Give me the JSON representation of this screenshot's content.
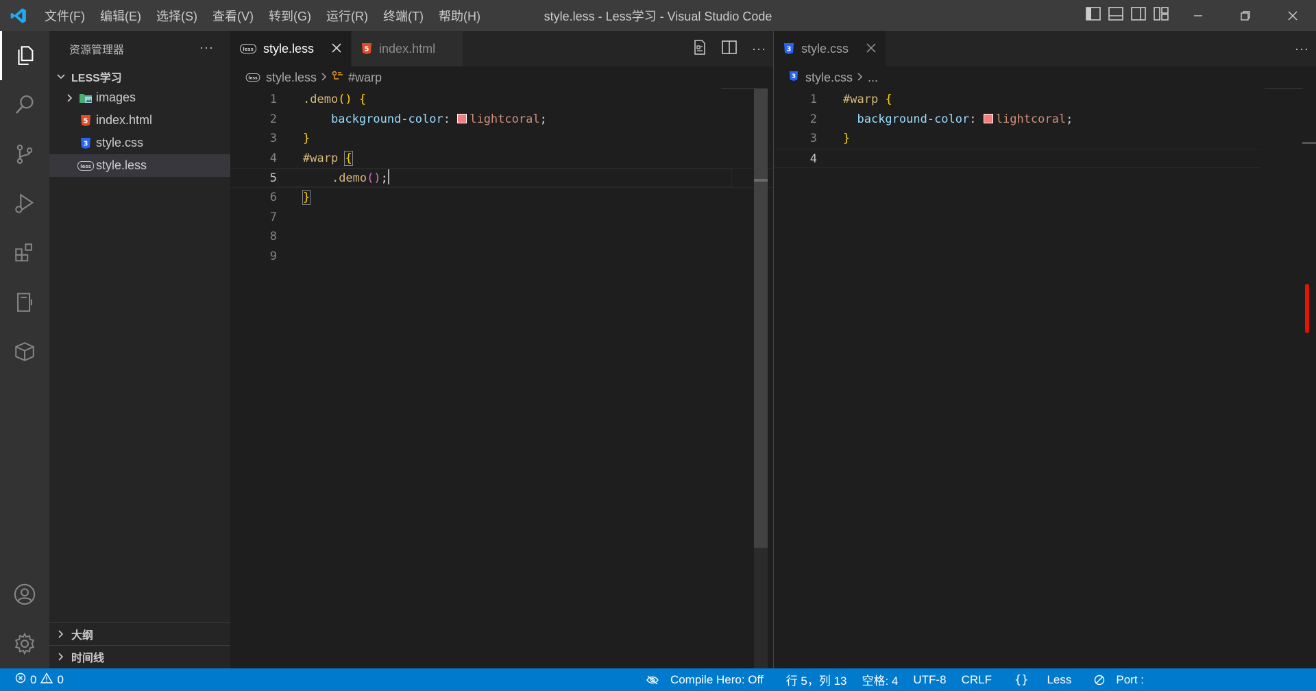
{
  "window": {
    "title": "style.less - Less学习 - Visual Studio Code",
    "menu": [
      "文件(F)",
      "编辑(E)",
      "选择(S)",
      "查看(V)",
      "转到(G)",
      "运行(R)",
      "终端(T)",
      "帮助(H)"
    ]
  },
  "sidebar": {
    "title": "资源管理器",
    "more": "···",
    "folder": "LESS学习",
    "items": [
      {
        "label": "images",
        "icon": "image-folder-icon"
      },
      {
        "label": "index.html",
        "icon": "html-file-icon"
      },
      {
        "label": "style.css",
        "icon": "css-file-icon"
      },
      {
        "label": "style.less",
        "icon": "less-file-icon"
      }
    ],
    "outline": "大纲",
    "timeline": "时间线"
  },
  "editor_left": {
    "tabs": [
      {
        "label": "style.less",
        "active": true
      },
      {
        "label": "index.html",
        "active": false
      }
    ],
    "breadcrumb": {
      "file": "style.less",
      "symbol": "#warp"
    },
    "line_numbers": [
      "1",
      "2",
      "3",
      "4",
      "5",
      "6",
      "7",
      "8",
      "9"
    ],
    "tokens": {
      "mixin": ".demo",
      "parens": "()",
      "brace_open": "{",
      "brace_close": "}",
      "property": "background-color",
      "colon": ":",
      "value": "lightcoral",
      "semicolon": ";",
      "selector": "#warp",
      "call": ".demo",
      "call_parens": "()"
    }
  },
  "editor_right": {
    "tabs": [
      {
        "label": "style.css",
        "active": true
      }
    ],
    "breadcrumb": {
      "file": "style.css",
      "more": "..."
    },
    "line_numbers": [
      "1",
      "2",
      "3",
      "4"
    ],
    "tokens": {
      "selector": "#warp",
      "brace_open": "{",
      "brace_close": "}",
      "property": "background-color",
      "colon": ":",
      "value": "lightcoral",
      "semicolon": ";"
    }
  },
  "colors": {
    "swatch": "#f08080",
    "status_bar": "#007acc",
    "accent": "#007acc"
  },
  "statusbar": {
    "errors": "0",
    "warnings": "0",
    "compile_hero": "Compile Hero: Off",
    "position": "行 5，列 13",
    "spaces": "空格: 4",
    "encoding": "UTF-8",
    "eol": "CRLF",
    "language": "Less",
    "port": "Port :"
  }
}
